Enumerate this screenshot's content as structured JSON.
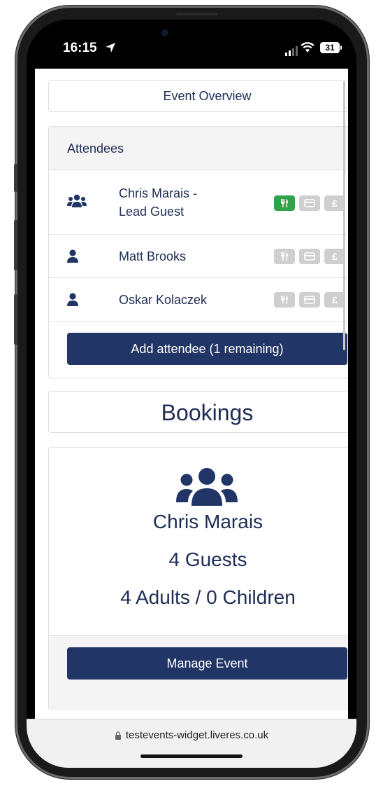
{
  "status": {
    "time": "16:15",
    "battery": "31"
  },
  "overview": {
    "title": "Event Overview"
  },
  "attendees": {
    "heading": "Attendees",
    "rows": [
      {
        "name": "Chris Marais -\nLead Guest",
        "type": "group",
        "meal": "green"
      },
      {
        "name": "Matt Brooks",
        "type": "person",
        "meal": "grey"
      },
      {
        "name": "Oskar Kolaczek",
        "type": "person",
        "meal": "grey"
      }
    ],
    "badge_currency": "£",
    "add_label": "Add attendee (1 remaining)"
  },
  "bookings": {
    "title": "Bookings",
    "name": "Chris Marais",
    "guests": "4 Guests",
    "split": "4 Adults / 0 Children",
    "manage_label": "Manage Event"
  },
  "browser": {
    "url": "testevents-widget.liveres.co.uk"
  },
  "colors": {
    "primary": "#213566",
    "text": "#1f2d55",
    "meal_active": "#2fa24a",
    "badge_inactive": "#cfcfcf"
  }
}
